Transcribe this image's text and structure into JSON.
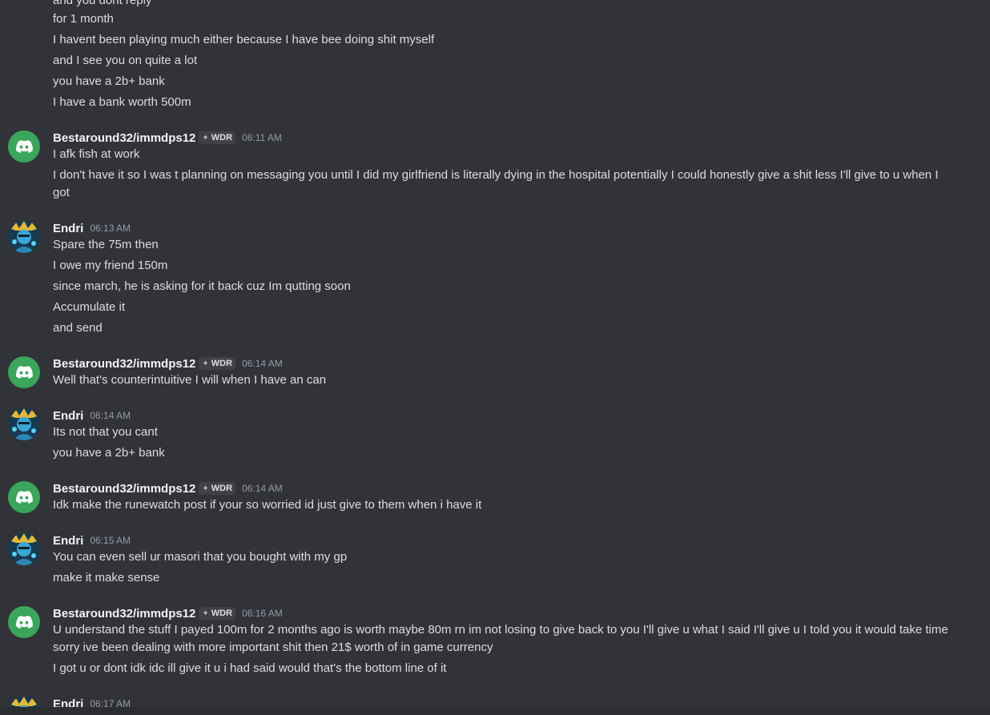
{
  "messages": [
    {
      "type": "line",
      "text": "and you dont reply"
    },
    {
      "type": "line",
      "text": "for 1 month"
    },
    {
      "type": "line",
      "text": "I havent been playing much either because I have bee doing shit myself"
    },
    {
      "type": "line",
      "text": "and I see you on quite a lot"
    },
    {
      "type": "line",
      "text": "you have a 2b+ bank"
    },
    {
      "type": "line",
      "text": "I have a bank worth 500m"
    },
    {
      "type": "header",
      "author": "Bestaround32/immdps12",
      "tag": "WDR",
      "time": "06:11 AM",
      "avatar": "discord-logo-icon"
    },
    {
      "type": "line",
      "text": "I afk fish at work"
    },
    {
      "type": "line",
      "text": "I don't have it so I was t planning on messaging you until I did my girlfriend is literally dying in the hospital potentially I could honestly give a shit less I'll give to u when I got"
    },
    {
      "type": "header",
      "author": "Endri",
      "time": "06:13 AM",
      "avatar": "endri-avatar"
    },
    {
      "type": "line",
      "text": "Spare the 75m then"
    },
    {
      "type": "line",
      "text": "I owe my friend 150m"
    },
    {
      "type": "line",
      "text": "since march, he is asking for it back cuz Im qutting soon"
    },
    {
      "type": "line",
      "text": "Accumulate it"
    },
    {
      "type": "line",
      "text": "and send"
    },
    {
      "type": "header",
      "author": "Bestaround32/immdps12",
      "tag": "WDR",
      "time": "06:14 AM",
      "avatar": "discord-logo-icon"
    },
    {
      "type": "line",
      "text": "Well that's counterintuitive I will when I have an can"
    },
    {
      "type": "header",
      "author": "Endri",
      "time": "06:14 AM",
      "avatar": "endri-avatar"
    },
    {
      "type": "line",
      "text": "Its not that you cant"
    },
    {
      "type": "line",
      "text": "you have a 2b+ bank"
    },
    {
      "type": "header",
      "author": "Bestaround32/immdps12",
      "tag": "WDR",
      "time": "06:14 AM",
      "avatar": "discord-logo-icon"
    },
    {
      "type": "line",
      "text": "Idk make the runewatch post if your so worried id just give to them when i have it"
    },
    {
      "type": "header",
      "author": "Endri",
      "time": "06:15 AM",
      "avatar": "endri-avatar"
    },
    {
      "type": "line",
      "text": "You can even sell ur masori that you bought with my gp"
    },
    {
      "type": "line",
      "text": "make it make sense"
    },
    {
      "type": "header",
      "author": "Bestaround32/immdps12",
      "tag": "WDR",
      "time": "06:16 AM",
      "avatar": "discord-logo-icon"
    },
    {
      "type": "line",
      "text": "U understand the stuff I payed 100m for 2 months ago is worth maybe 80m rn im not losing to give back to you I'll give u what I said I'll give u I told you it would take time sorry ive been dealing with more important shit then 21$ worth of in game currency"
    },
    {
      "type": "line",
      "text": "I got u or dont idk idc ill give it u i had said would that's the bottom line of it"
    },
    {
      "type": "header",
      "author": "Endri",
      "time": "06:17 AM",
      "avatar": "endri-avatar"
    }
  ],
  "colors": {
    "background": "#313338",
    "text": "#dbdee1",
    "username": "#f2f3f5",
    "timestamp": "#949ba4",
    "discord_avatar": "#3ba55c"
  }
}
